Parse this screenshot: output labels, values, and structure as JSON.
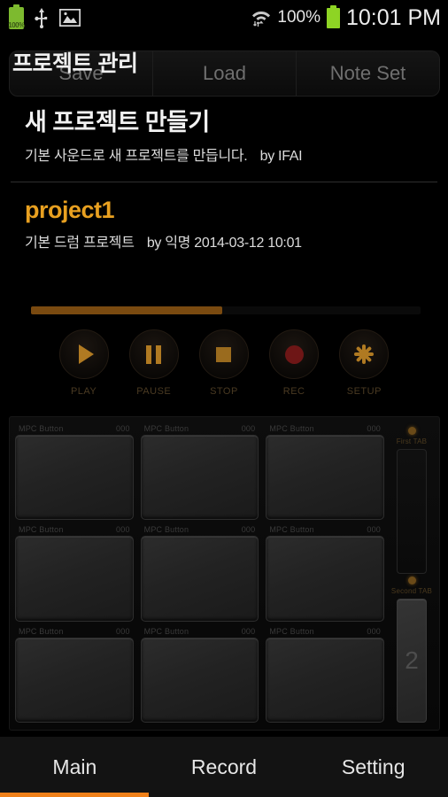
{
  "statusbar": {
    "battery_label": "100%",
    "battery_icon": "battery-icon",
    "usb_icon": "usb-icon",
    "image_icon": "image-icon",
    "wifi_icon": "wifi-icon",
    "battery_percent": "100%",
    "battery_icon_right": "battery-icon",
    "time": "10:01 PM"
  },
  "header": {
    "title": "프로젝트 관리"
  },
  "tabs": [
    {
      "label": "Save"
    },
    {
      "label": "Load"
    },
    {
      "label": "Note Set"
    }
  ],
  "projects": [
    {
      "title": "새 프로젝트 만들기",
      "subtitle": "기본 사운드로 새 프로젝트를 만듭니다.",
      "author": "by IFAI",
      "accent": false
    },
    {
      "title": "project1",
      "subtitle": "기본 드럼 프로젝트",
      "author": "by 익명 2014-03-12 10:01",
      "accent": true
    }
  ],
  "progress": {
    "percent": 49
  },
  "transport": [
    {
      "label": "PLAY",
      "icon": "play-icon"
    },
    {
      "label": "PAUSE",
      "icon": "pause-icon"
    },
    {
      "label": "STOP",
      "icon": "stop-icon"
    },
    {
      "label": "REC",
      "icon": "record-icon"
    },
    {
      "label": "SETUP",
      "icon": "setup-icon"
    }
  ],
  "pads": [
    {
      "label": "MPC Button",
      "value": "000"
    },
    {
      "label": "MPC Button",
      "value": "000"
    },
    {
      "label": "MPC Button",
      "value": "000"
    },
    {
      "label": "MPC Button",
      "value": "000"
    },
    {
      "label": "MPC Button",
      "value": "000"
    },
    {
      "label": "MPC Button",
      "value": "000"
    },
    {
      "label": "MPC Button",
      "value": "000"
    },
    {
      "label": "MPC Button",
      "value": "000"
    },
    {
      "label": "MPC Button",
      "value": "000"
    }
  ],
  "side_tabs": [
    {
      "label": "First TAB",
      "value": ""
    },
    {
      "label": "Second TAB",
      "value": "2"
    }
  ],
  "bottom_nav": [
    {
      "label": "Main",
      "active": true
    },
    {
      "label": "Record",
      "active": false
    },
    {
      "label": "Setting",
      "active": false
    }
  ],
  "colors": {
    "accent": "#e8a020",
    "nav_indicator": "#ef8019",
    "battery_green": "#8ed424",
    "progress_fill": "#7a4a10"
  }
}
